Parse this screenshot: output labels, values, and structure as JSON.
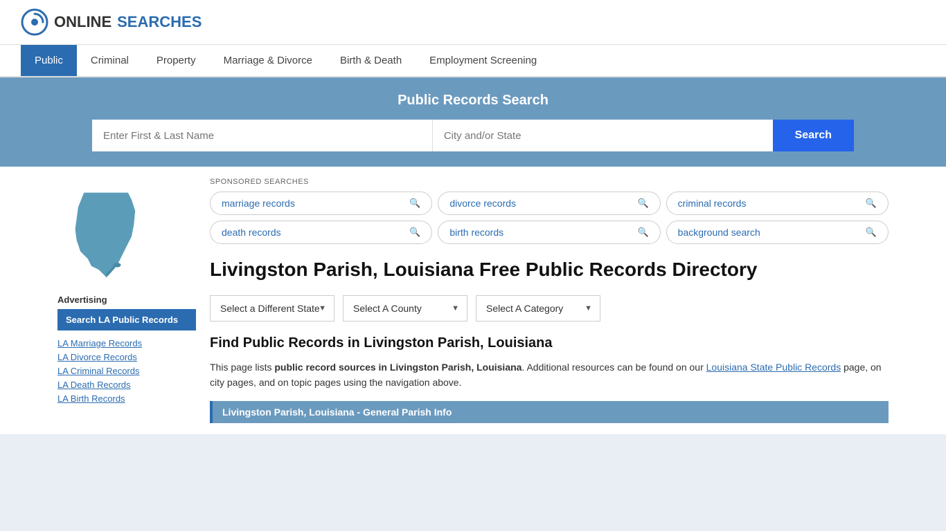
{
  "logo": {
    "text_online": "ONLINE",
    "text_searches": "SEARCHES"
  },
  "nav": {
    "items": [
      {
        "label": "Public",
        "active": true
      },
      {
        "label": "Criminal",
        "active": false
      },
      {
        "label": "Property",
        "active": false
      },
      {
        "label": "Marriage & Divorce",
        "active": false
      },
      {
        "label": "Birth & Death",
        "active": false
      },
      {
        "label": "Employment Screening",
        "active": false
      }
    ]
  },
  "search_banner": {
    "title": "Public Records Search",
    "name_placeholder": "Enter First & Last Name",
    "location_placeholder": "City and/or State",
    "button_label": "Search"
  },
  "sponsored": {
    "label": "SPONSORED SEARCHES",
    "items": [
      {
        "label": "marriage records"
      },
      {
        "label": "divorce records"
      },
      {
        "label": "criminal records"
      },
      {
        "label": "death records"
      },
      {
        "label": "birth records"
      },
      {
        "label": "background search"
      }
    ]
  },
  "page": {
    "title": "Livingston Parish, Louisiana Free Public Records Directory",
    "find_title": "Find Public Records in Livingston Parish, Louisiana",
    "description_part1": "This page lists ",
    "description_bold": "public record sources in Livingston Parish, Louisiana",
    "description_part2": ". Additional resources can be found on our ",
    "description_link": "Louisiana State Public Records",
    "description_part3": " page, on city pages, and on topic pages using the navigation above.",
    "info_bar": "Livingston Parish, Louisiana - General Parish Info"
  },
  "dropdowns": {
    "state_label": "Select a Different State",
    "county_label": "Select A County",
    "category_label": "Select A Category"
  },
  "sidebar": {
    "advertising_label": "Advertising",
    "ad_button_label": "Search LA Public Records",
    "links": [
      {
        "label": "LA Marriage Records"
      },
      {
        "label": "LA Divorce Records"
      },
      {
        "label": "LA Criminal Records"
      },
      {
        "label": "LA Death Records"
      },
      {
        "label": "LA Birth Records"
      }
    ]
  }
}
